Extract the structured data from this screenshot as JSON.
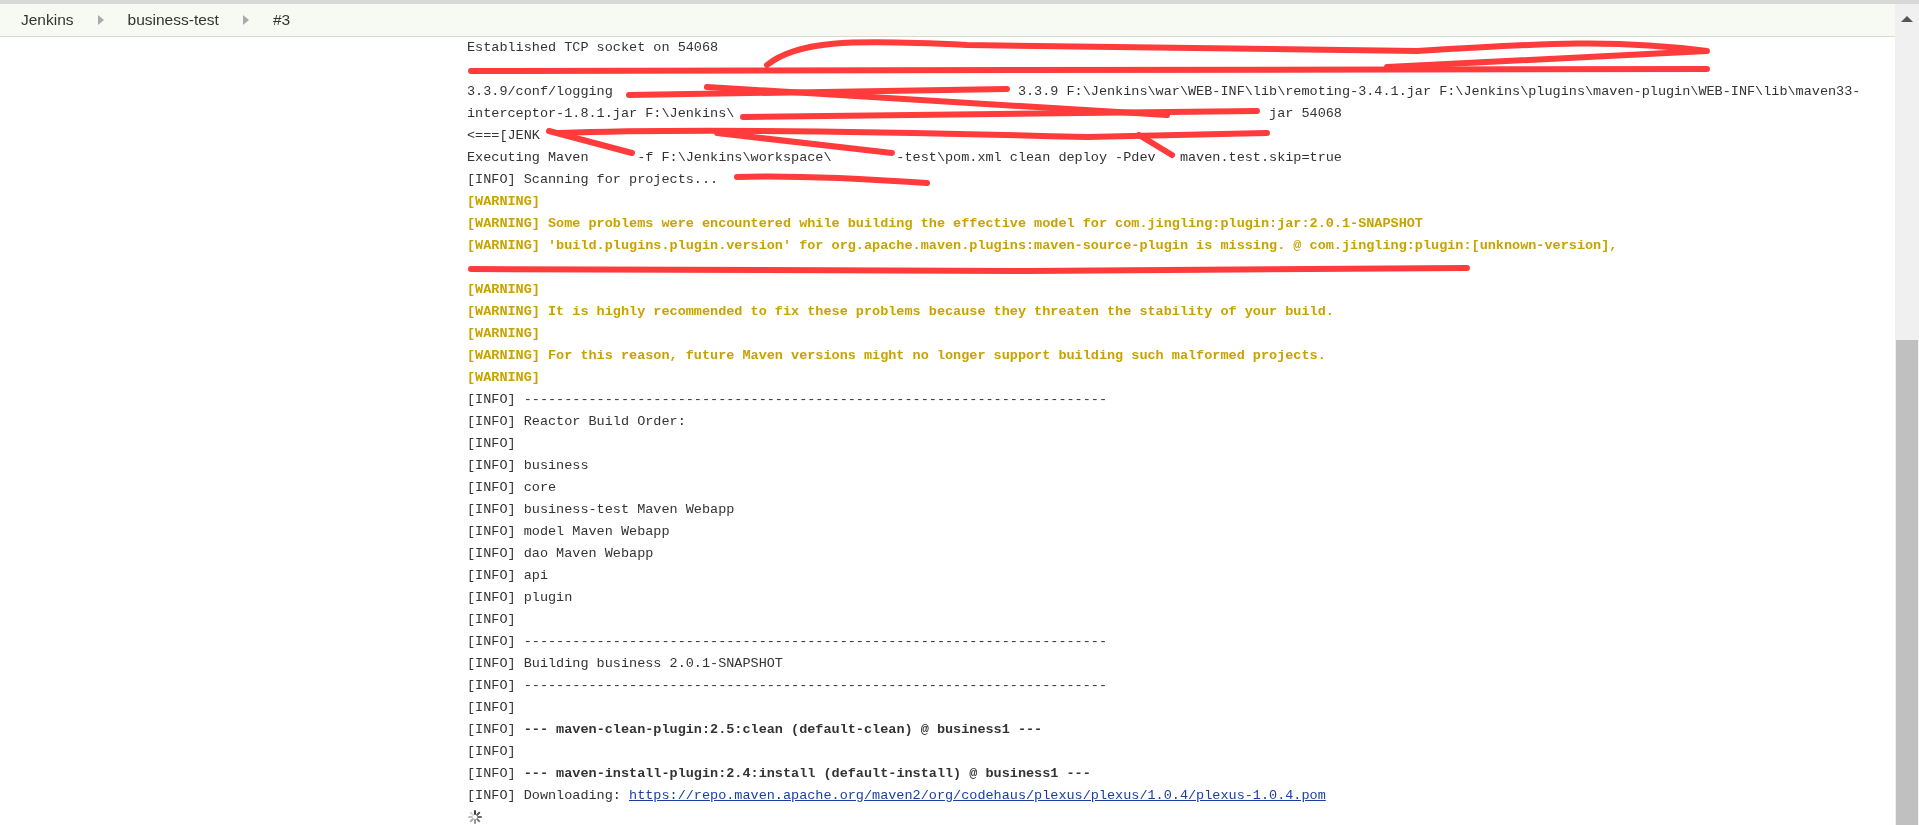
{
  "breadcrumbs": [
    {
      "label": "Jenkins"
    },
    {
      "label": "business-test"
    },
    {
      "label": "#3"
    }
  ],
  "console": {
    "lines": [
      {
        "kind": "plain",
        "text": "Established TCP socket on 54068"
      },
      {
        "kind": "redacted"
      },
      {
        "kind": "plain",
        "text": "3.3.9/conf/logging                                                  3.3.9 F:\\Jenkins\\war\\WEB-INF\\lib\\remoting-3.4.1.jar F:\\Jenkins\\plugins\\maven-plugin\\WEB-INF\\lib\\maven33-"
      },
      {
        "kind": "plain",
        "text": "interceptor-1.8.1.jar F:\\Jenkins\\                                                                  jar 54068"
      },
      {
        "kind": "plain",
        "text": "<===[JENK"
      },
      {
        "kind": "plain",
        "text": "Executing Maven      -f F:\\Jenkins\\workspace\\        -test\\pom.xml clean deploy -Pdev   maven.test.skip=true"
      },
      {
        "kind": "info",
        "text": "[INFO] Scanning for projects..."
      },
      {
        "kind": "warning",
        "text": "[WARNING]"
      },
      {
        "kind": "warning",
        "text": "[WARNING] Some problems were encountered while building the effective model for com.jingling:plugin:jar:2.0.1-SNAPSHOT"
      },
      {
        "kind": "warning",
        "text": "[WARNING] 'build.plugins.plugin.version' for org.apache.maven.plugins:maven-source-plugin is missing. @ com.jingling:plugin:[unknown-version],"
      },
      {
        "kind": "redacted"
      },
      {
        "kind": "warning",
        "text": "[WARNING]"
      },
      {
        "kind": "warning",
        "text": "[WARNING] It is highly recommended to fix these problems because they threaten the stability of your build."
      },
      {
        "kind": "warning",
        "text": "[WARNING]"
      },
      {
        "kind": "warning",
        "text": "[WARNING] For this reason, future Maven versions might no longer support building such malformed projects."
      },
      {
        "kind": "warning",
        "text": "[WARNING]"
      },
      {
        "kind": "info",
        "text": "[INFO] ------------------------------------------------------------------------"
      },
      {
        "kind": "info",
        "text": "[INFO] Reactor Build Order:"
      },
      {
        "kind": "info",
        "text": "[INFO]"
      },
      {
        "kind": "info",
        "text": "[INFO] business"
      },
      {
        "kind": "info",
        "text": "[INFO] core"
      },
      {
        "kind": "info",
        "text": "[INFO] business-test Maven Webapp"
      },
      {
        "kind": "info",
        "text": "[INFO] model Maven Webapp"
      },
      {
        "kind": "info",
        "text": "[INFO] dao Maven Webapp"
      },
      {
        "kind": "info",
        "text": "[INFO] api"
      },
      {
        "kind": "info",
        "text": "[INFO] plugin"
      },
      {
        "kind": "info",
        "text": "[INFO]"
      },
      {
        "kind": "info",
        "text": "[INFO] ------------------------------------------------------------------------"
      },
      {
        "kind": "info",
        "text": "[INFO] Building business 2.0.1-SNAPSHOT"
      },
      {
        "kind": "info",
        "text": "[INFO] ------------------------------------------------------------------------"
      },
      {
        "kind": "info",
        "text": "[INFO]"
      },
      {
        "kind": "info",
        "text": "[INFO] **--- maven-clean-plugin:2.5:clean (default-clean) @ business1 ---**"
      },
      {
        "kind": "info",
        "text": "[INFO]"
      },
      {
        "kind": "info",
        "text": "[INFO] **--- maven-install-plugin:2.4:install (default-install) @ business1 ---**"
      },
      {
        "kind": "link",
        "text": "[INFO] Downloading: ",
        "link": "https://repo.maven.apache.org/maven2/org/codehaus/plexus/plexus/1.0.4/plexus-1.0.4.pom"
      }
    ],
    "loading": true
  }
}
